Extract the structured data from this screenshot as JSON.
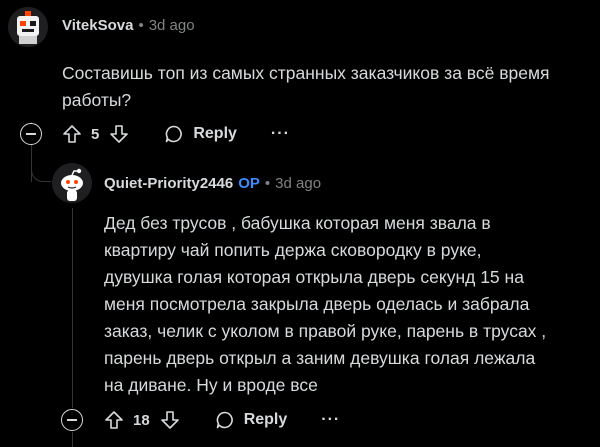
{
  "comments": [
    {
      "username": "VitekSova",
      "is_op": false,
      "timestamp": "3d ago",
      "body_lines": [
        "Составишь топ из самых странных заказчиков за всё время",
        "работы?"
      ],
      "score": "5",
      "reply_label": "Reply",
      "more_label": "···"
    },
    {
      "username": "Quiet-Priority2446",
      "is_op": true,
      "op_label": "OP",
      "timestamp": "3d ago",
      "body_lines": [
        "Дед без трусов , бабушка которая меня звала в",
        "квартиру чай попить держа сковородку в руке,",
        "дувушка голая которая открыла дверь секунд 15 на",
        "меня посмотрела закрыла дверь оделась и забрала",
        "заказ, челик с уколом в правой руке, парень в трусах ,",
        "парень дверь открыл а заним девушка голая лежала",
        "на диване. Ну и вроде все"
      ],
      "score": "18",
      "reply_label": "Reply",
      "more_label": "···"
    }
  ],
  "separator": "•",
  "colors": {
    "background": "#000000",
    "text": "#d7dadc",
    "meta": "#818384",
    "op": "#3b8bff",
    "thread_line": "#343536"
  }
}
